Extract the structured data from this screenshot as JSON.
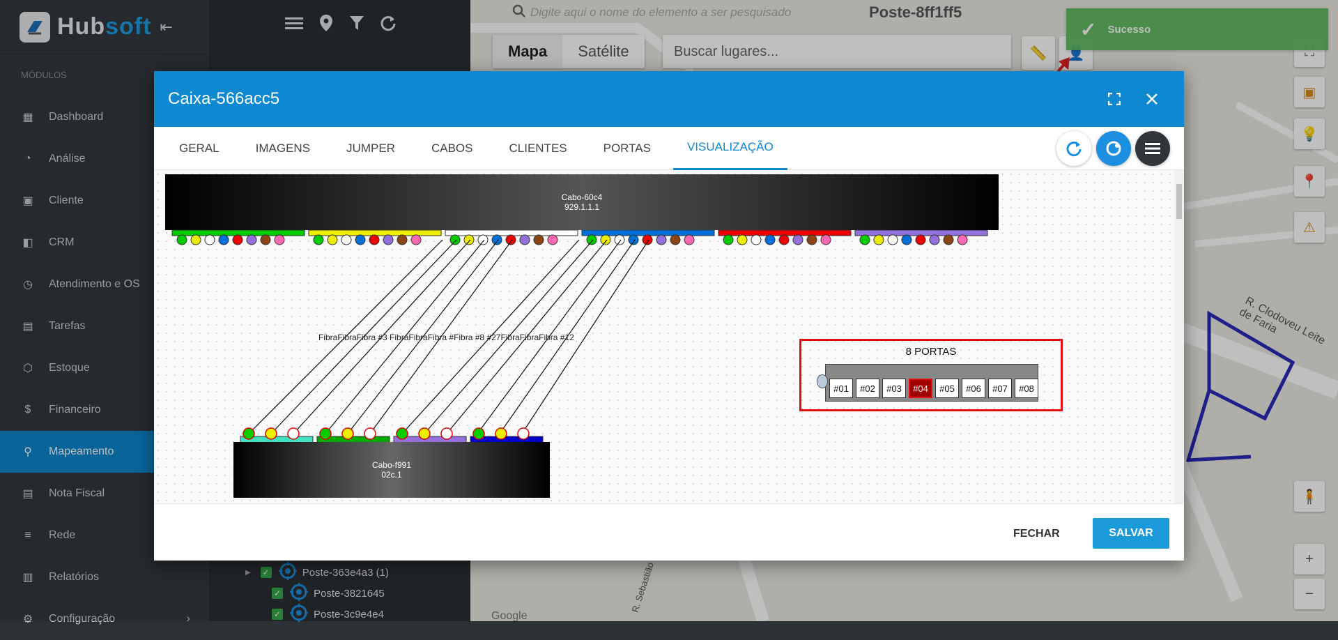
{
  "app": {
    "logo_text_1": "Hub",
    "logo_text_2": "soft",
    "section_label": "MÓDULOS"
  },
  "sidebar": {
    "items": [
      {
        "label": "Dashboard",
        "icon": "dashboard-icon"
      },
      {
        "label": "Análise",
        "icon": "pie-chart-icon"
      },
      {
        "label": "Cliente",
        "icon": "contact-card-icon"
      },
      {
        "label": "CRM",
        "icon": "crm-board-icon"
      },
      {
        "label": "Atendimento e OS",
        "icon": "calendar-clock-icon"
      },
      {
        "label": "Tarefas",
        "icon": "task-calendar-icon"
      },
      {
        "label": "Estoque",
        "icon": "box-icon"
      },
      {
        "label": "Financeiro",
        "icon": "money-icon"
      },
      {
        "label": "Mapeamento",
        "icon": "map-pin-icon",
        "active": true
      },
      {
        "label": "Nota Fiscal",
        "icon": "document-icon"
      },
      {
        "label": "Rede",
        "icon": "server-icon"
      },
      {
        "label": "Relatórios",
        "icon": "report-icon"
      },
      {
        "label": "Configuração",
        "icon": "gear-icon"
      }
    ]
  },
  "tree": {
    "rows": [
      "Poste-363e4a3 (1)",
      "Poste-3821645",
      "Poste-3c9e4e4"
    ]
  },
  "map": {
    "search_placeholder": "Digite aqui o nome do elemento a ser pesquisado",
    "element_title": "Poste-8ff1ff5",
    "type_map": "Mapa",
    "type_satellite": "Satélite",
    "places_placeholder": "Buscar lugares...",
    "street_labels": [
      "R. Clodoveu Leite de Faria",
      "R. Sebastião",
      "Google"
    ]
  },
  "toast": {
    "text": "Sucesso",
    "color": "#5cb85c"
  },
  "modal": {
    "title": "Caixa-566acc5",
    "tabs": [
      "GERAL",
      "IMAGENS",
      "JUMPER",
      "CABOS",
      "CLIENTES",
      "PORTAS",
      "VISUALIZAÇÃO"
    ],
    "active_tab": "VISUALIZAÇÃO",
    "close_label": "FECHAR",
    "save_label": "SALVAR",
    "accent": "#0d88d1"
  },
  "diagram": {
    "top_cable": {
      "name": "Cabo-60c4",
      "id": "929.1.1.1"
    },
    "bottom_cable": {
      "name": "Cabo-f991",
      "id": "02c.1"
    },
    "fiber_labels": "FibraFibraFibra #3  FibraFibraFibra #Fibra #8 #27FibraFibraFibra #12",
    "splitter": {
      "title": "8 PORTAS",
      "ports": [
        "#01",
        "#02",
        "#03",
        "#04",
        "#05",
        "#06",
        "#07",
        "#08"
      ],
      "highlighted_port": "#04"
    },
    "tube_colors_top": [
      "#00cc00",
      "#eeee00",
      "#ffffff",
      "#0070d8",
      "#ee0000",
      "#9370db"
    ],
    "fiber_colors": [
      "#00cc00",
      "#eeee00",
      "#ffffff",
      "#0070d8",
      "#ee0000",
      "#9370db",
      "#8b4513",
      "#ff69b4"
    ],
    "tube_colors_bottom": [
      "#40e0c0",
      "#00aa00",
      "#9370db",
      "#0000cc"
    ]
  }
}
